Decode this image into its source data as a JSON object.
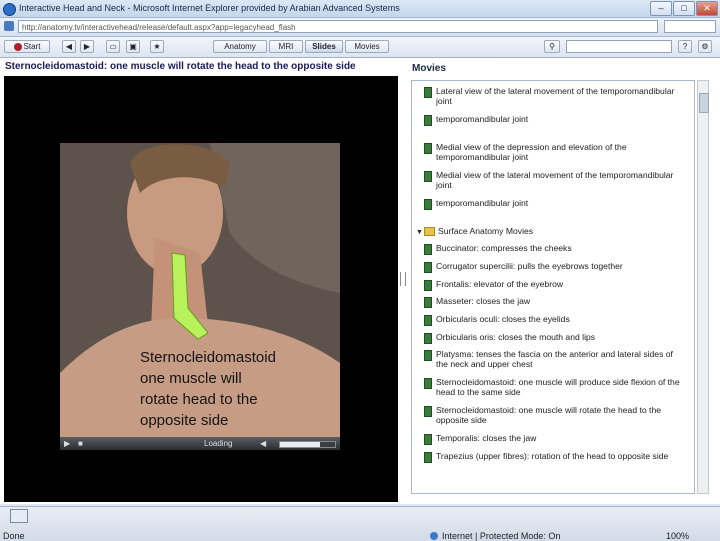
{
  "window": {
    "title": "Interactive Head and Neck - Microsoft Internet Explorer provided by Arabian Advanced Systems",
    "address": "http://anatomy.tv/interactivehead/release/default.aspx?app=legacyhead_flash"
  },
  "toolbar": {
    "start_label": "Start",
    "tabs": [
      {
        "label": "Anatomy",
        "selected": false
      },
      {
        "label": "MRI",
        "selected": false
      },
      {
        "label": "Slides",
        "selected": true
      },
      {
        "label": "Movies",
        "selected": false
      }
    ]
  },
  "slide": {
    "title": "Sternocleidomastoid: one muscle will rotate the head to the opposite side",
    "caption_lines": [
      "Sternocleidomastoid",
      "one muscle will",
      "rotate head to the",
      "opposite side"
    ],
    "player_status": "Loading",
    "progress": 0.72
  },
  "movies": {
    "heading": "Movies",
    "items_top": [
      "Lateral view of the lateral movement of the temporomandibular joint",
      "temporomandibular joint",
      "Medial view of the depression and elevation of the temporomandibular joint",
      "Medial view of the lateral movement of the temporomandibular joint",
      "temporomandibular joint"
    ],
    "folder": "Surface Anatomy Movies",
    "items_surface": [
      "Buccinator: compresses the cheeks",
      "Corrugator supercilii: pulls the eyebrows together",
      "Frontalis: elevator of the eyebrow",
      "Masseter: closes the jaw",
      "Orbicularis oculi: closes the eyelids",
      "Orbicularis oris: closes the mouth and lips",
      "Platysma: tenses the fascia on the anterior and lateral sides of the neck and upper chest",
      "Sternocleidomastoid: one muscle will produce side flexion of the head to the same side",
      "Sternocleidomastoid: one muscle will rotate the head to the opposite side",
      "Temporalis: closes the jaw",
      "Trapezius (upper fibres): rotation of the head to opposite side"
    ]
  },
  "status": {
    "done": "Done",
    "zone": "Internet | Protected Mode: On",
    "zoom": "100%"
  },
  "colors": {
    "muscle_highlight": "#b8f25a",
    "file_icon": "#3a7a3a",
    "folder_icon": "#e5c34c"
  }
}
